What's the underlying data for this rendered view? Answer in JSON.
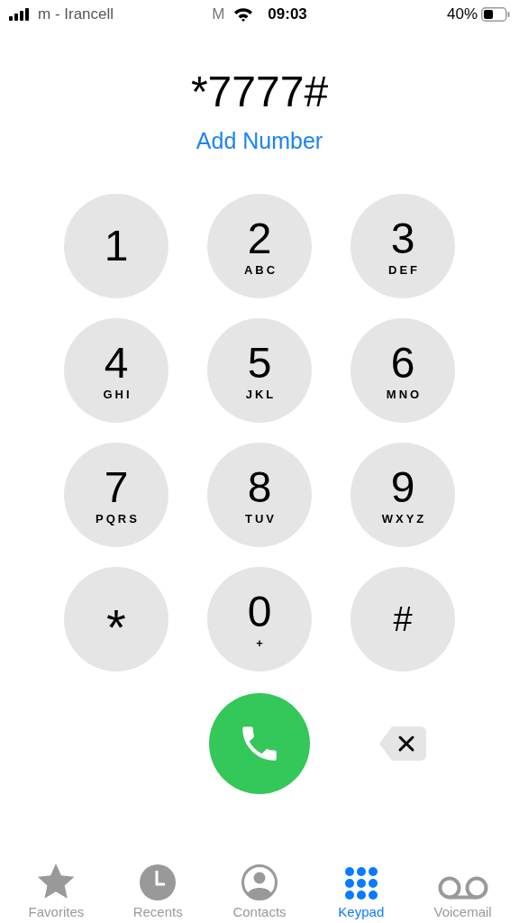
{
  "status_bar": {
    "carrier": "m - Irancell",
    "indicator": "M",
    "time": "09:03",
    "battery": "40%"
  },
  "number": "*7777#",
  "add_number": "Add Number",
  "keys": [
    {
      "digit": "1"
    },
    {
      "digit": "2",
      "letters": "ABC"
    },
    {
      "digit": "3",
      "letters": "DEF"
    },
    {
      "digit": "4",
      "letters": "GHI"
    },
    {
      "digit": "5",
      "letters": "JKL"
    },
    {
      "digit": "6",
      "letters": "MNO"
    },
    {
      "digit": "7",
      "letters": "PQRS"
    },
    {
      "digit": "8",
      "letters": "TUV"
    },
    {
      "digit": "9",
      "letters": "WXYZ"
    },
    {
      "digit": "*"
    },
    {
      "digit": "0",
      "letters": "+"
    },
    {
      "digit": "#"
    }
  ],
  "tabs": [
    {
      "kind": "favorites",
      "label": "Favorites",
      "selected": false
    },
    {
      "kind": "recents",
      "label": "Recents",
      "selected": false
    },
    {
      "kind": "contacts",
      "label": "Contacts",
      "selected": false
    },
    {
      "kind": "keypad",
      "label": "Keypad",
      "selected": true
    },
    {
      "kind": "voicemail",
      "label": "Voicemail",
      "selected": false
    }
  ]
}
